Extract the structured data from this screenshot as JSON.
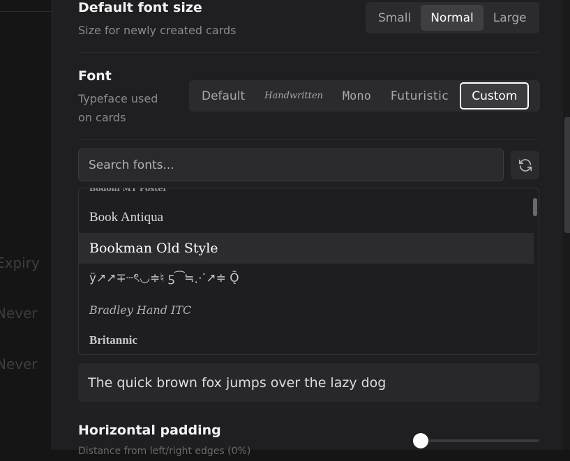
{
  "background": {
    "texts": [
      "Expiry",
      "Never",
      "Never"
    ]
  },
  "font_size": {
    "title": "Default font size",
    "description": "Size for newly created cards",
    "options": [
      "Small",
      "Normal",
      "Large"
    ],
    "selected": "Normal"
  },
  "font": {
    "title": "Font",
    "description_line1": "Typeface used",
    "description_line2": "on cards",
    "options": [
      "Default",
      "Handwritten",
      "Mono",
      "Futuristic",
      "Custom"
    ],
    "selected": "Custom"
  },
  "search": {
    "placeholder": "Search fonts..."
  },
  "font_list": {
    "items": [
      "Bodoni MT Poster",
      "Book Antiqua",
      "Bookman Old Style",
      "ÿ↗↗∓┄ৎ◡≑♮ ƽ⁀≒⋰↗≑ Ǭ",
      "Bradley Hand ITC",
      "Britannic"
    ],
    "selected": "Bookman Old Style"
  },
  "preview": {
    "text": "The quick brown fox jumps over the lazy dog"
  },
  "horizontal_padding": {
    "title": "Horizontal padding",
    "description": "Distance from left/right edges (0%)",
    "value": 0
  },
  "colors": {
    "accent": "#ffffff",
    "panel": "#1f1f21",
    "selected_option": "#3f3f43"
  },
  "icons": {
    "refresh": "refresh-icon"
  }
}
